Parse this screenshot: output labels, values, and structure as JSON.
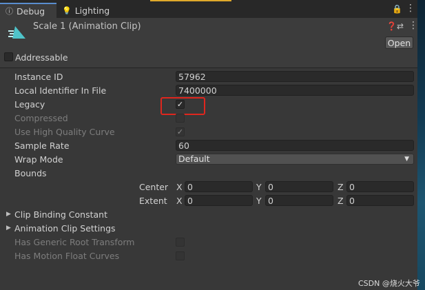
{
  "tabs": [
    {
      "label": "Debug",
      "icon": "info-icon",
      "active": true
    },
    {
      "label": "Lighting",
      "icon": "lightbulb-icon",
      "active": false
    }
  ],
  "header": {
    "title": "Scale 1 (Animation Clip)",
    "open_label": "Open",
    "addressable_label": "Addressable",
    "addressable_checked": false
  },
  "properties": {
    "instance_id": {
      "label": "Instance ID",
      "value": "57962"
    },
    "local_identifier": {
      "label": "Local Identifier In File",
      "value": "7400000"
    },
    "legacy": {
      "label": "Legacy",
      "checked": true
    },
    "compressed": {
      "label": "Compressed",
      "checked": false
    },
    "high_quality_curve": {
      "label": "Use High Quality Curve",
      "checked": true
    },
    "sample_rate": {
      "label": "Sample Rate",
      "value": "60"
    },
    "wrap_mode": {
      "label": "Wrap Mode",
      "value": "Default"
    },
    "bounds": {
      "label": "Bounds",
      "center": {
        "label": "Center",
        "x": "0",
        "y": "0",
        "z": "0"
      },
      "extent": {
        "label": "Extent",
        "x": "0",
        "y": "0",
        "z": "0"
      },
      "axis_x": "X",
      "axis_y": "Y",
      "axis_z": "Z"
    },
    "clip_binding_constant": {
      "label": "Clip Binding Constant"
    },
    "animation_clip_settings": {
      "label": "Animation Clip Settings"
    },
    "has_generic_root_transform": {
      "label": "Has Generic Root Transform",
      "checked": false
    },
    "has_motion_float_curves": {
      "label": "Has Motion Float Curves",
      "checked": false
    }
  },
  "watermark": "CSDN @烧火大爷",
  "colors": {
    "accent": "#5a8ecf",
    "highlight": "#e0261e",
    "clip_icon": "#4fc3c9"
  }
}
